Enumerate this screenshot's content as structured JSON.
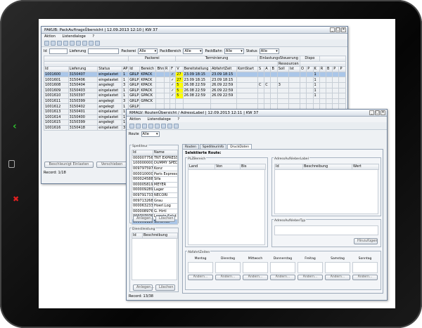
{
  "device": {
    "back_label": "‹",
    "close_label": "✖"
  },
  "win1": {
    "title": "PAKUB: PackAuftragsÜbersicht | 12.09.2013 12:10 | KW 37",
    "menu": [
      "Aktion",
      "Listendialoge",
      "?"
    ],
    "filters": {
      "id_label": "Id",
      "lieferung_label": "Lieferung",
      "packerei_label": "Packerei",
      "packerei_value": "Alle",
      "packbereich_label": "PackBereich",
      "packbereich_value": "Alle",
      "packbahn_label": "PackBahn",
      "packbahn_value": "Alle",
      "status_label": "Status",
      "status_value": "Alle"
    },
    "groups": [
      "Packerei",
      "Terminierung",
      "EinlastungsSteuerung",
      "Dispo"
    ],
    "subgroup": "Ressourcen",
    "columns": [
      "Id",
      "Lieferung",
      "Status",
      "AP",
      "Id",
      "Bereich",
      "Bhn",
      "R",
      "F",
      "V",
      "Bereitstellung",
      "AbfahrtZeit",
      "KomStart",
      "S",
      "A",
      "B",
      "Soll",
      "Ist",
      "O",
      "P",
      "K",
      "R",
      "B",
      "P",
      "P"
    ],
    "rows": [
      {
        "id": "1001600",
        "lief": "3150407",
        "status": "eingelastet",
        "ap": "1",
        "grp": "GRLP",
        "ber": "KPACK",
        "v": "27",
        "bereit": "23.09 18:15",
        "abf": "23.09 18:15",
        "s": "",
        "a": "",
        "soll": "",
        "ist": "",
        "k": "1",
        "hl": true
      },
      {
        "id": "1001601",
        "lief": "3150406",
        "status": "eingelastet",
        "ap": "1",
        "grp": "GRLP",
        "ber": "KPACK",
        "v": "27",
        "bereit": "23.09 18:15",
        "abf": "23.09 18:15",
        "s": "",
        "a": "",
        "soll": "",
        "ist": "",
        "k": "1",
        "hl": false
      },
      {
        "id": "1001608",
        "lief": "3150404",
        "status": "angelegt",
        "ap": "3",
        "grp": "GRLP",
        "ber": "KPACK",
        "v": "5",
        "bereit": "26.08 22:59",
        "abf": "26.09 22:59",
        "s": "C",
        "a": "C",
        "soll": "3",
        "ist": "",
        "k": "1",
        "hl": false
      },
      {
        "id": "1001609",
        "lief": "3150403",
        "status": "eingelastet",
        "ap": "1",
        "grp": "GRLP",
        "ber": "KPACK",
        "v": "5",
        "bereit": "26.08 22:59",
        "abf": "26.09 22:59",
        "s": "",
        "a": "",
        "soll": "",
        "ist": "",
        "k": "1",
        "hl": false
      },
      {
        "id": "1001610",
        "lief": "3150397",
        "status": "eingelastet",
        "ap": "1",
        "grp": "GRLP",
        "ber": "GPACK",
        "v": "5",
        "bereit": "26.08 22:59",
        "abf": "26.09 22:59",
        "s": "",
        "a": "",
        "soll": "",
        "ist": "",
        "k": "1",
        "hl": false
      },
      {
        "id": "1001611",
        "lief": "3150399",
        "status": "angelegt",
        "ap": "3",
        "grp": "GRLP",
        "ber": "GPACK",
        "v": "",
        "bereit": "",
        "abf": "",
        "s": "",
        "a": "",
        "soll": "",
        "ist": "",
        "k": "",
        "hl": false
      },
      {
        "id": "1001612",
        "lief": "3150402",
        "status": "angelegt",
        "ap": "1",
        "grp": "GRLP",
        "ber": "",
        "v": "",
        "bereit": "",
        "abf": "",
        "s": "",
        "a": "",
        "soll": "",
        "ist": "",
        "k": "",
        "hl": false
      },
      {
        "id": "1001613",
        "lief": "3150401",
        "status": "eingelastet",
        "ap": "1",
        "grp": "HRL",
        "ber": "",
        "v": "",
        "bereit": "",
        "abf": "",
        "s": "",
        "a": "",
        "soll": "",
        "ist": "",
        "k": "",
        "hl": false
      },
      {
        "id": "1001614",
        "lief": "3150400",
        "status": "eingelastet",
        "ap": "1",
        "grp": "HRL",
        "ber": "",
        "v": "",
        "bereit": "",
        "abf": "",
        "s": "",
        "a": "",
        "soll": "",
        "ist": "",
        "k": "",
        "hl": false
      },
      {
        "id": "1001615",
        "lief": "3150399",
        "status": "angelegt",
        "ap": "1",
        "grp": "GRLP",
        "ber": "",
        "v": "",
        "bereit": "",
        "abf": "",
        "s": "",
        "a": "",
        "soll": "",
        "ist": "",
        "k": "",
        "hl": false
      },
      {
        "id": "1001616",
        "lief": "3150418",
        "status": "eingelastet",
        "ap": "3",
        "grp": "GRLP",
        "ber": "",
        "v": "",
        "bereit": "",
        "abf": "",
        "s": "",
        "a": "",
        "soll": "",
        "ist": "",
        "k": "",
        "hl": false
      }
    ],
    "btn_einlasten": "Beschleunigt Einlasten",
    "btn_verschieben": "Verschieben",
    "record": "Record: 1/18"
  },
  "win2": {
    "title": "RMALV: RoutenÜbersicht / AdressLabel | 12.09.2013 12:11 | KW 37",
    "menu": [
      "Aktion",
      "Listendialoge",
      "?"
    ],
    "route_label": "Route",
    "route_value": "Alle",
    "spediteur_title": "Spediteur",
    "sped_columns": [
      "Id",
      "Name"
    ],
    "spediteure": [
      {
        "id": "0000077563",
        "name": "TNT EXPRESS"
      },
      {
        "id": "1000000000",
        "name": "DUMMY SPEDI"
      },
      {
        "id": "0097975972",
        "name": "Konz"
      },
      {
        "id": "0000100004",
        "name": "Paris Express N"
      },
      {
        "id": "0000245885",
        "name": "Sifa"
      },
      {
        "id": "0000058194",
        "name": "MEYER"
      },
      {
        "id": "0000092897",
        "name": "Lager"
      },
      {
        "id": "0097917334",
        "name": "NECORI"
      },
      {
        "id": "0097132687",
        "name": "Grau"
      },
      {
        "id": "0000632331",
        "name": "Hoerl.Log"
      },
      {
        "id": "0000089769",
        "name": "G. Hirtl"
      },
      {
        "id": "0097079762",
        "name": "Logwin Solut"
      },
      {
        "id": "0000011250",
        "name": "Schenker"
      }
    ],
    "btn_anlegen": "Anlegen...",
    "btn_loeschen": "Löschen",
    "dienst_title": "Dienstleistung",
    "dienst_columns": [
      "Id",
      "Beschreibung"
    ],
    "btn_anlegen2": "Anlegen...",
    "btn_loeschen2": "Löschen",
    "tabs": [
      "Routen",
      "Spediteurinfo",
      "DruckDaten"
    ],
    "selected_route_label": "Selektierte Route:",
    "plz_title": "PLZBereich",
    "plz_columns": [
      "Land",
      "Von",
      "Bis"
    ],
    "adress_title": "AdressAufkleberLabel",
    "adress_columns": [
      "Id",
      "Beschreibung",
      "Wert"
    ],
    "adress_typ_title": "AdressAufkleberTyp",
    "btn_hinzufuegen": "Hinzufügen",
    "abfahrt_title": "AbfahrtZeiten",
    "weekdays": [
      "Montag",
      "Dienstag",
      "Mittwoch",
      "Donnerstag",
      "Freitag",
      "Samstag",
      "Sonntag"
    ],
    "btn_aendern": "Ändern...",
    "record": "Record: 13/38"
  }
}
